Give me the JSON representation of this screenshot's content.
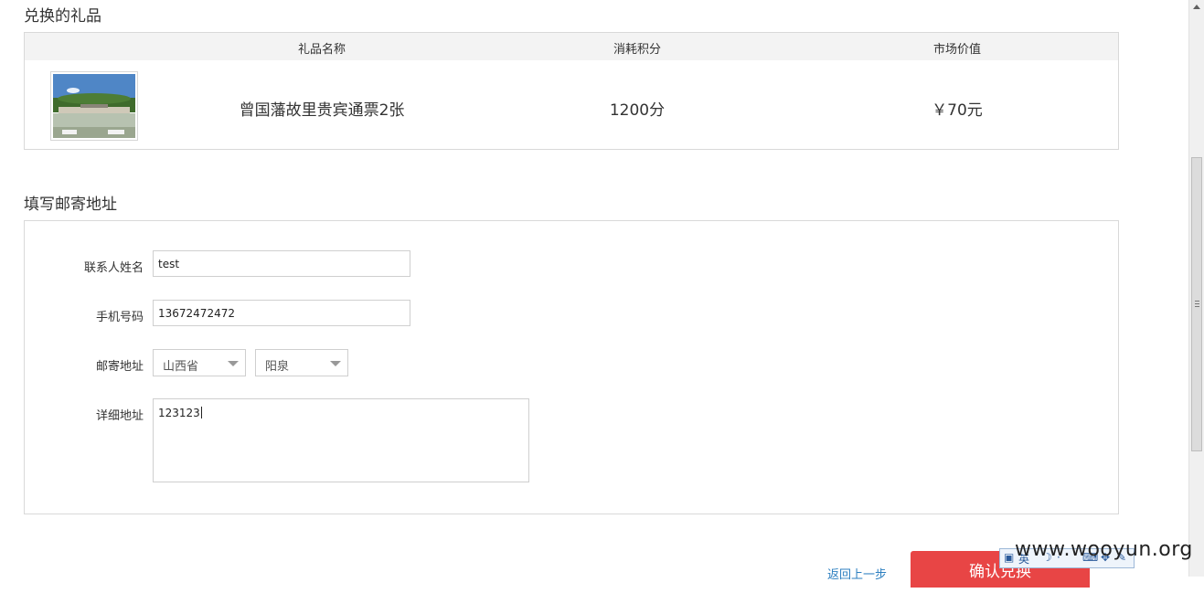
{
  "gift_section": {
    "title": "兑换的礼品",
    "headers": {
      "name": "礼品名称",
      "points": "消耗积分",
      "value": "市场价值"
    },
    "item": {
      "name": "曾国藩故里贵宾通票2张",
      "points_value": "1200",
      "points_unit": "分",
      "market_value": "￥70元"
    }
  },
  "address_section": {
    "title": "填写邮寄地址",
    "contact_label": "联系人姓名",
    "contact_value": "test",
    "phone_label": "手机号码",
    "phone_value": "13672472472",
    "region_label": "邮寄地址",
    "province_selected": "山西省",
    "city_selected": "阳泉",
    "detail_label": "详细地址",
    "detail_value": "123123"
  },
  "actions": {
    "back_label": "返回上一步",
    "confirm_label": "确认兑换"
  },
  "ime_toolbar": {
    "mode": "英"
  },
  "watermark": "www.wooyun.org",
  "colors": {
    "accent_red": "#e84545",
    "points_red": "#e0453c",
    "link_blue": "#2c7fc0"
  }
}
